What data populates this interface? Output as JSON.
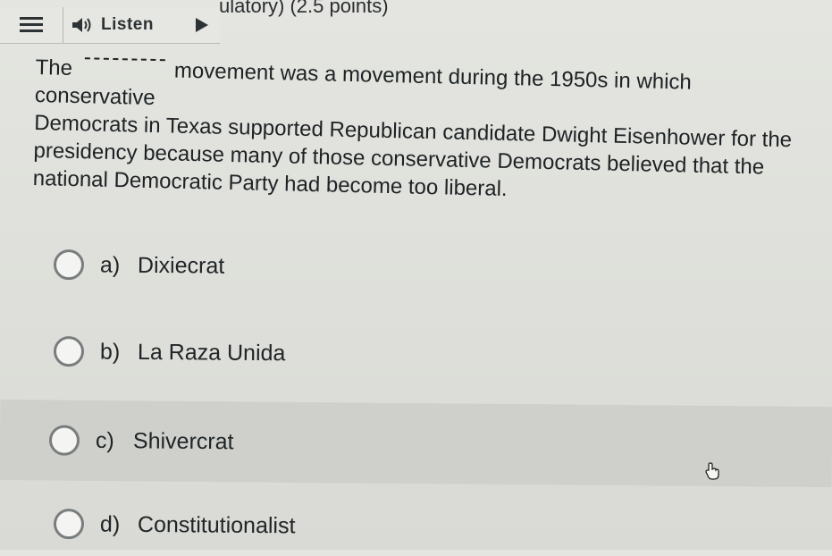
{
  "header": {
    "points_text": "ulatory) (2.5 points)"
  },
  "toolbar": {
    "listen_label": "Listen",
    "menu_icon": "hamburger-icon",
    "speaker_icon": "speaker-icon",
    "play_icon": "play-icon"
  },
  "question": {
    "prefix": "The",
    "blank": "",
    "line1": "movement was a movement during the 1950s in which conservative",
    "line2": "Democrats in Texas supported Republican candidate Dwight Eisenhower for the",
    "line3": "presidency because many of those conservative Democrats believed that the",
    "line4": "national Democratic Party had become too liberal."
  },
  "options": [
    {
      "letter": "a)",
      "text": "Dixiecrat"
    },
    {
      "letter": "b)",
      "text": "La Raza Unida"
    },
    {
      "letter": "c)",
      "text": "Shivercrat"
    },
    {
      "letter": "d)",
      "text": "Constitutionalist"
    }
  ],
  "colors": {
    "background": "#dfe0db",
    "hover_row": "#cfd0cb",
    "text": "#1d2224"
  }
}
